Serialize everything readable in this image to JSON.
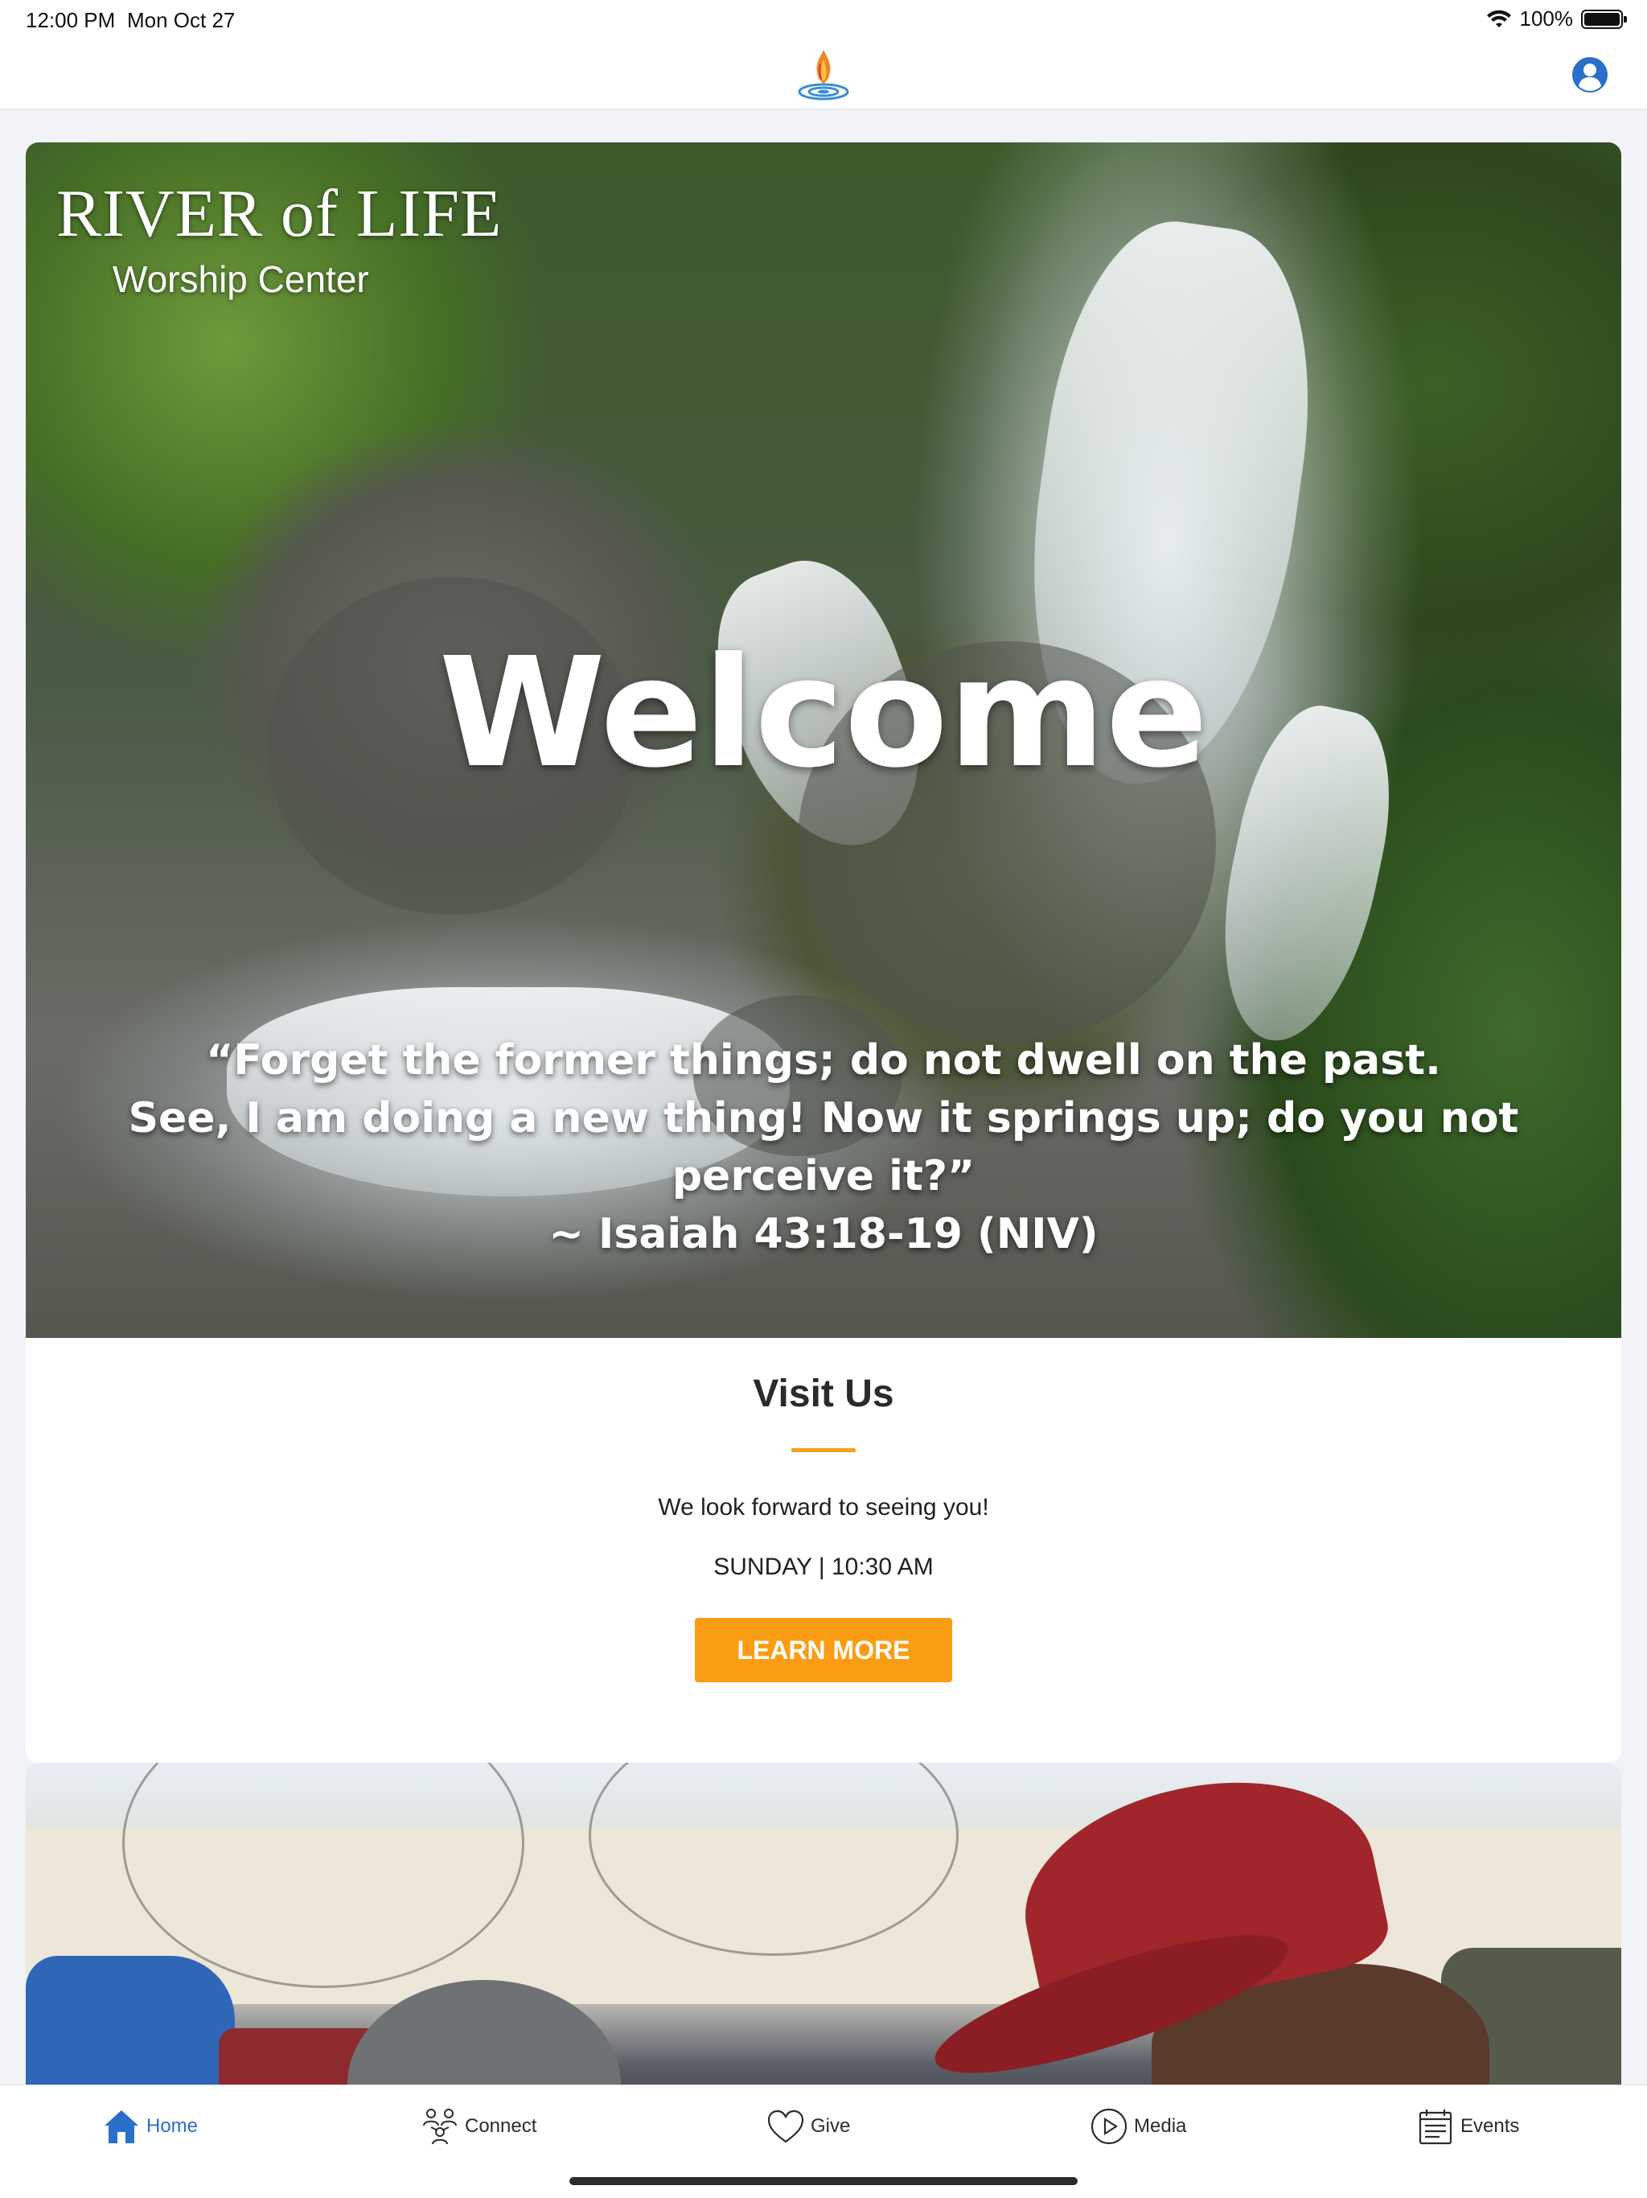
{
  "status_bar": {
    "time": "12:00 PM",
    "date": "Mon Oct 27",
    "battery": "100%"
  },
  "header": {
    "logo_icon": "flame-water-logo",
    "profile_icon": "user-circle-icon",
    "accent_color": "#2a6fc9"
  },
  "hero": {
    "brand_title": "RIVER of LIFE",
    "brand_subtitle": "Worship Center",
    "headline": "Welcome",
    "quote_line_1": "“Forget the former things; do not dwell on the past.",
    "quote_line_2": "See, I am doing a new thing!  Now it springs up; do you not perceive it?”",
    "quote_citation": "~ Isaiah 43:18-19 (NIV)"
  },
  "visit": {
    "title": "Visit Us",
    "text": "We look forward to seeing you!",
    "schedule": "SUNDAY | 10:30 AM",
    "button_label": "LEARN MORE",
    "button_color": "#fb9d13",
    "divider_color": "#f7a11a"
  },
  "tabs": [
    {
      "label": "Home",
      "icon": "home-icon",
      "active": true
    },
    {
      "label": "Connect",
      "icon": "people-icon",
      "active": false
    },
    {
      "label": "Give",
      "icon": "heart-icon",
      "active": false
    },
    {
      "label": "Media",
      "icon": "play-circle-icon",
      "active": false
    },
    {
      "label": "Events",
      "icon": "calendar-icon",
      "active": false
    }
  ]
}
